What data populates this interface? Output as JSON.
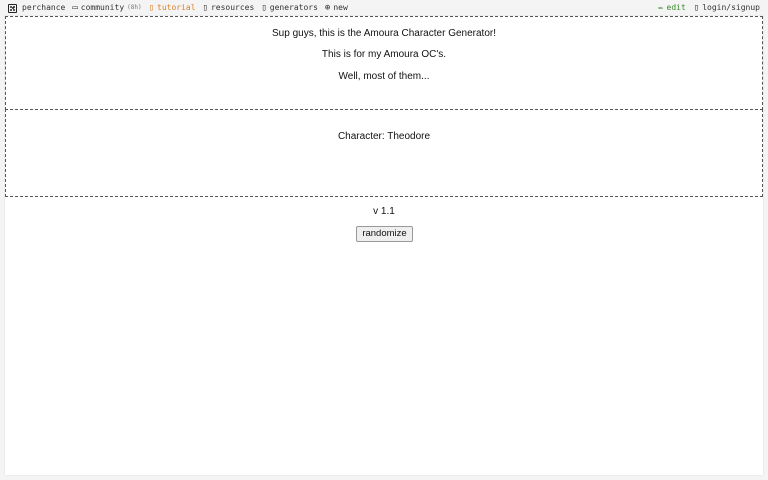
{
  "nav": {
    "left": [
      {
        "label": "perchance",
        "icon": "dice-icon"
      },
      {
        "label": "community",
        "count": "(8h)",
        "icon": "chat-icon"
      },
      {
        "label": "tutorial",
        "icon": "book-icon"
      },
      {
        "label": "resources",
        "icon": "resources-icon"
      },
      {
        "label": "generators",
        "icon": "generators-icon"
      },
      {
        "label": "new",
        "icon": "plus-circle-icon"
      }
    ],
    "right": [
      {
        "label": "edit",
        "icon": "pencil-icon"
      },
      {
        "label": "login/signup",
        "icon": "user-icon"
      }
    ]
  },
  "main": {
    "intro": [
      "Sup guys, this is the Amoura Character Generator!",
      "This is for my Amoura OC's.",
      "Well, most of them..."
    ],
    "character": "Character: Theodore",
    "version": "v 1.1",
    "button_label": "randomize"
  },
  "colors": {
    "tutorial": "#d9822b",
    "edit": "#3b8a2f",
    "border": "#555555"
  }
}
